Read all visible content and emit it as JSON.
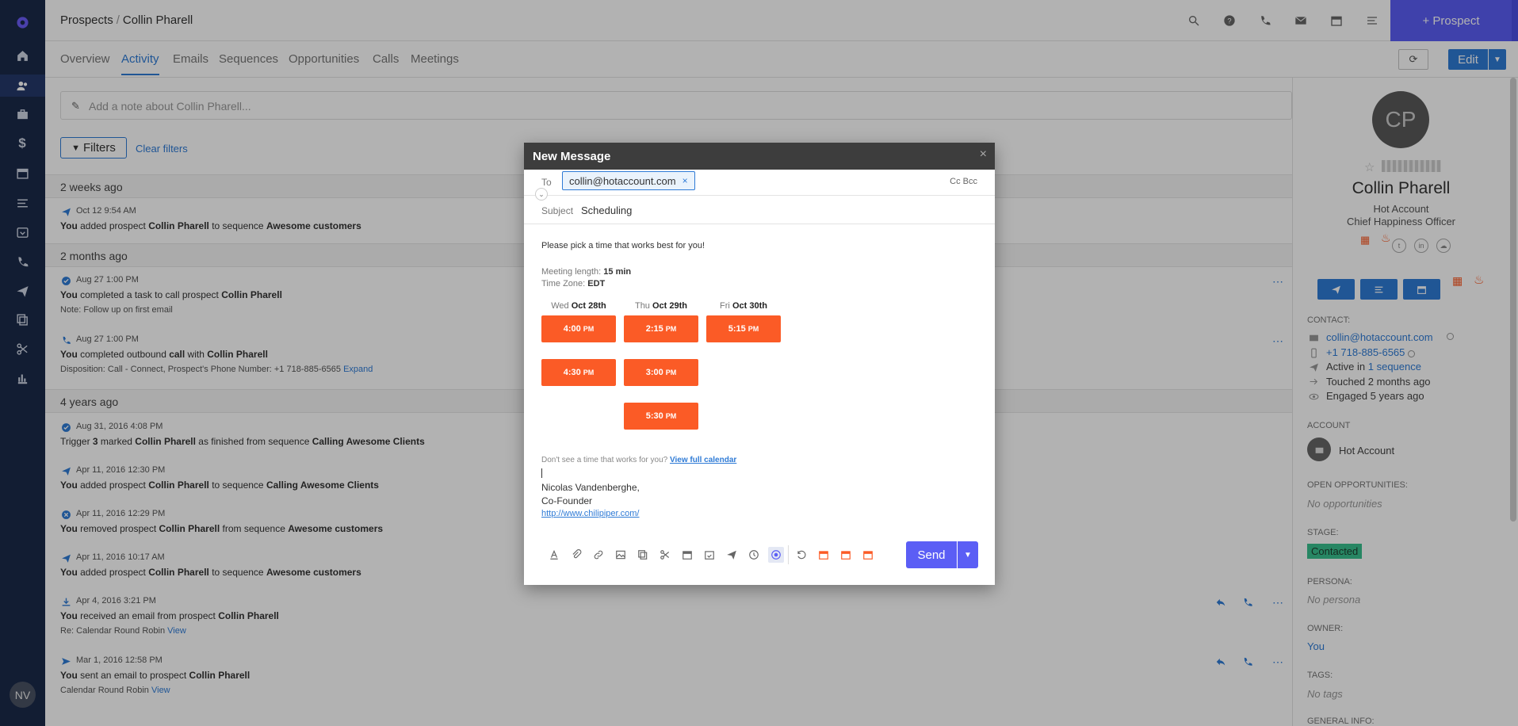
{
  "sidebar": {
    "user_initials": "NV"
  },
  "header": {
    "breadcrumb_root": "Prospects",
    "breadcrumb_sep": "/",
    "breadcrumb_current": "Collin Pharell",
    "new_prospect_label": "+ Prospect"
  },
  "tabs": [
    "Overview",
    "Activity",
    "Emails",
    "Sequences",
    "Opportunities",
    "Calls",
    "Meetings"
  ],
  "toolbar": {
    "edit_label": "Edit"
  },
  "note": {
    "placeholder": "Add a note about Collin Pharell..."
  },
  "filters": {
    "label": "Filters",
    "clear_label": "Clear filters"
  },
  "groups": [
    "2 weeks ago",
    "2 months ago",
    "4 years ago"
  ],
  "activities": [
    {
      "date": "Oct 12 9:54 AM",
      "p1": "You",
      "p2": " added prospect ",
      "p3": "Collin Pharell",
      "p4": " to sequence ",
      "p5": "Awesome customers"
    },
    {
      "date": "Aug 27 1:00 PM",
      "p1": "You",
      "p2": " completed a task to call prospect ",
      "p3": "Collin Pharell",
      "p4": "",
      "p5": "",
      "sub": "Note: Follow up on first email"
    },
    {
      "date": "Aug 27 1:00 PM",
      "p1": "You",
      "p2": " completed outbound ",
      "p3": "call",
      "p4": " with ",
      "p5": "Collin Pharell",
      "sub": "Disposition: Call - Connect, Prospect's Phone Number: +1 718-885-6565",
      "sub_link": "Expand"
    },
    {
      "date": "Aug 31, 2016 4:08 PM",
      "p0": "Trigger ",
      "p1": "3",
      "p2": " marked ",
      "p3": "Collin Pharell",
      "p4": " as finished from sequence ",
      "p5": "Calling Awesome Clients"
    },
    {
      "date": "Apr 11, 2016 12:30 PM",
      "p1": "You",
      "p2": " added prospect ",
      "p3": "Collin Pharell",
      "p4": " to sequence ",
      "p5": "Calling Awesome Clients"
    },
    {
      "date": "Apr 11, 2016 12:29 PM",
      "p1": "You",
      "p2": " removed prospect ",
      "p3": "Collin Pharell",
      "p4": " from sequence ",
      "p5": "Awesome customers"
    },
    {
      "date": "Apr 11, 2016 10:17 AM",
      "p1": "You",
      "p2": " added prospect ",
      "p3": "Collin Pharell",
      "p4": " to sequence ",
      "p5": "Awesome customers"
    },
    {
      "date": "Apr 4, 2016 3:21 PM",
      "p1": "You",
      "p2": " received an email from prospect ",
      "p3": "Collin Pharell",
      "p4": "",
      "p5": "",
      "sub": "Re: Calendar Round Robin",
      "sub_link": "View"
    },
    {
      "date": "Mar 1, 2016 12:58 PM",
      "p1": "You",
      "p2": " sent an email to prospect ",
      "p3": "Collin Pharell",
      "p4": "",
      "p5": "",
      "sub": "Calendar Round Robin",
      "sub_link": "View"
    }
  ],
  "modal": {
    "title": "New Message",
    "to_label": "To",
    "to_email": "collin@hotaccount.com",
    "cc_bcc": "Cc  Bcc",
    "subject_label": "Subject",
    "subject_value": "Scheduling",
    "body_intro": "Please pick a time that works best for you!",
    "meeting_length_label": "Meeting length: ",
    "meeting_length": "15 min",
    "timezone_label": "Time Zone: ",
    "timezone": "EDT",
    "days": [
      {
        "dow": "Wed",
        "date": "Oct 28th",
        "slots": [
          "4:00",
          "4:30"
        ]
      },
      {
        "dow": "Thu",
        "date": "Oct 29th",
        "slots": [
          "2:15",
          "3:00",
          "5:30"
        ]
      },
      {
        "dow": "Fri",
        "date": "Oct 30th",
        "slots": [
          "5:15"
        ]
      }
    ],
    "slot_suffix": "PM",
    "dont_see": "Don't see a time that works for you?",
    "view_calendar": "View full calendar",
    "sig_name": "Nicolas Vandenberghe,",
    "sig_title": "Co-Founder",
    "sig_link": "http://www.chilipiper.com/",
    "send_label": "Send"
  },
  "profile": {
    "initials": "CP",
    "name": "Collin Pharell",
    "account": "Hot Account",
    "title": "Chief Happiness Officer",
    "contact_label": "CONTACT:",
    "email": "collin@hotaccount.com",
    "phone": "+1 718-885-6565",
    "active_prefix": "Active in ",
    "active_link": "1 sequence",
    "touched": "Touched 2 months ago",
    "engaged": "Engaged 5 years ago",
    "account_label": "ACCOUNT",
    "account_name": "Hot Account",
    "opps_label": "OPEN OPPORTUNITIES:",
    "opps_value": "No opportunities",
    "stage_label": "STAGE:",
    "stage_value": "Contacted",
    "persona_label": "PERSONA:",
    "persona_value": "No persona",
    "owner_label": "OWNER:",
    "owner_value": "You",
    "tags_label": "TAGS:",
    "tags_value": "No tags",
    "general_label": "GENERAL INFO:"
  }
}
